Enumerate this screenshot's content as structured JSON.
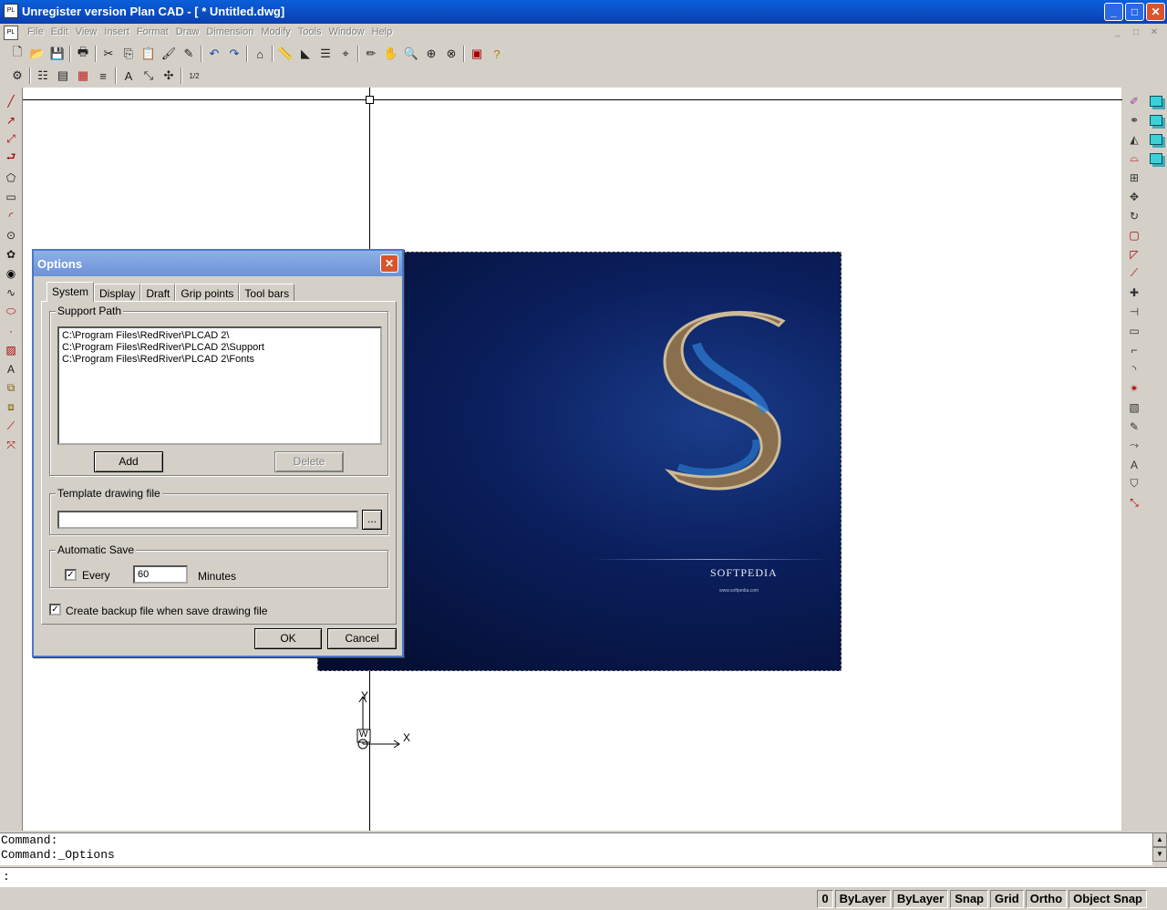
{
  "window": {
    "title": "Unregister version Plan CAD - [ * Untitled.dwg]",
    "app_icon_text": "PL",
    "minimize": "_",
    "maximize": "□",
    "close": "✕"
  },
  "menu": {
    "doc_icon_text": "PL",
    "items": [
      "File",
      "Edit",
      "View",
      "Insert",
      "Format",
      "Draw",
      "Dimension",
      "Modify",
      "Tools",
      "Window",
      "Help"
    ],
    "mdi": [
      "_",
      "□",
      "✕"
    ]
  },
  "canvas": {
    "picture_brand": "SOFTPEDIA",
    "picture_url": "www.softpedia.com",
    "ucs_x": "X",
    "ucs_y": "Y",
    "ucs_w": "W"
  },
  "command": {
    "lines": [
      "Command:",
      "Command:_Options"
    ],
    "prompt": ":"
  },
  "status": {
    "cells": [
      "0",
      "ByLayer",
      "ByLayer",
      "Snap",
      "Grid",
      "Ortho",
      "Object Snap"
    ]
  },
  "dialog": {
    "title": "Options",
    "close": "✕",
    "tabs": [
      "System",
      "Display",
      "Draft",
      "Grip points",
      "Tool bars"
    ],
    "support_path": {
      "label": "Support Path",
      "items": [
        "C:\\Program Files\\RedRiver\\PLCAD 2\\",
        "C:\\Program Files\\RedRiver\\PLCAD 2\\Support",
        "C:\\Program Files\\RedRiver\\PLCAD 2\\Fonts"
      ],
      "add": "Add",
      "delete": "Delete"
    },
    "template": {
      "label": "Template drawing file",
      "value": "",
      "browse": "..."
    },
    "autosave": {
      "label": "Automatic Save",
      "every_label": "Every",
      "every_checked": "✓",
      "minutes_value": "60",
      "minutes_label": "Minutes"
    },
    "backup": {
      "checked": "✓",
      "label": "Create backup file when save drawing file"
    },
    "ok": "OK",
    "cancel": "Cancel"
  }
}
